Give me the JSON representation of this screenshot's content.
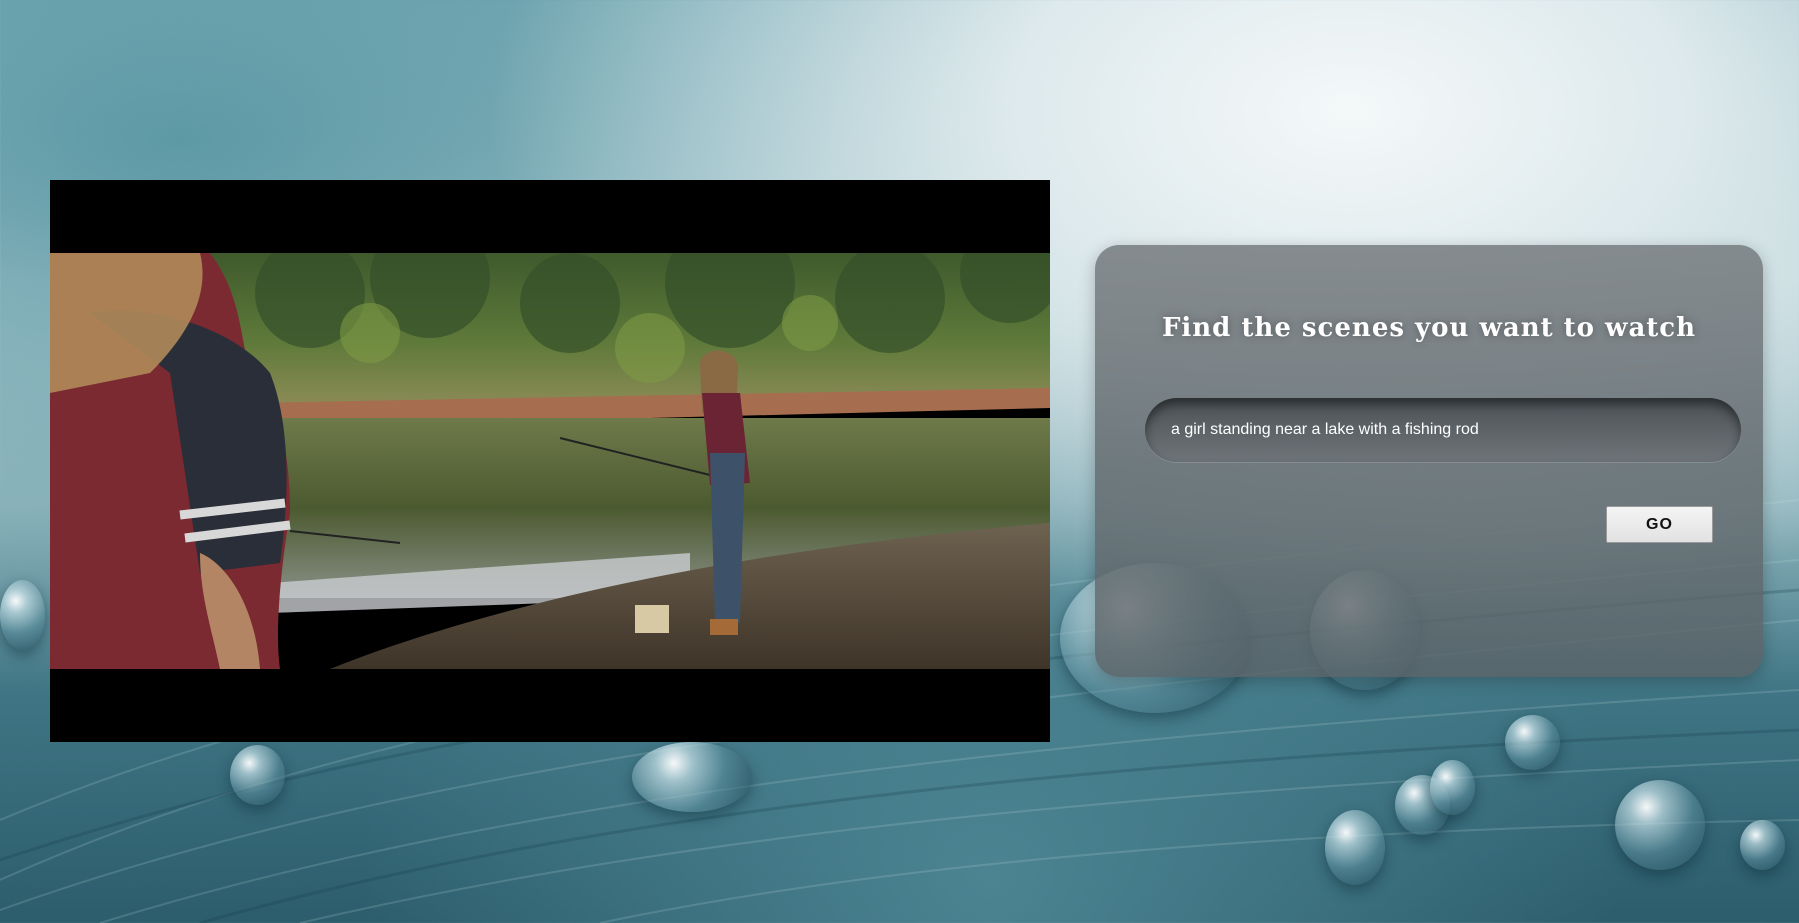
{
  "search_panel": {
    "title": "Find the scenes you want to watch",
    "query_value": "a girl standing near a lake with a fishing rod",
    "go_label": "GO"
  },
  "video": {
    "scene_icon": "video-frame"
  },
  "colors": {
    "panel_bg": "#6e767a",
    "button_bg": "#ececec",
    "video_bg": "#000000"
  }
}
